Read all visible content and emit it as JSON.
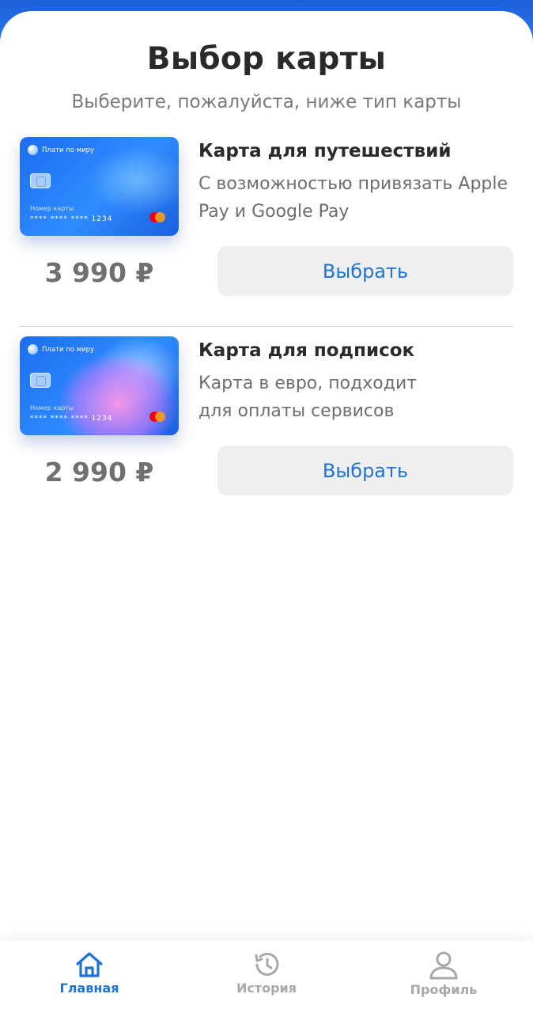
{
  "header": {
    "title": "Выбор карты",
    "subtitle": "Выберите, пожалуйста, ниже тип карты"
  },
  "offers": [
    {
      "card": {
        "brand": "Плати по миру",
        "number_label": "Номер карты",
        "number": "****  ****  ****  1234"
      },
      "title": "Карта для путешествий",
      "description": "С возможностью привязать Apple Pay и Google Pay",
      "price": "3 990 ₽",
      "button_label": "Выбрать"
    },
    {
      "card": {
        "brand": "Плати по миру",
        "number_label": "Номер карты",
        "number": "****  ****  ****  1234"
      },
      "title": "Карта для подписок",
      "description": "Карта в евро, подходит для оплаты сервисов",
      "price": "2 990 ₽",
      "button_label": "Выбрать"
    }
  ],
  "tabbar": {
    "items": [
      {
        "label": "Главная",
        "icon": "home-icon",
        "active": true
      },
      {
        "label": "История",
        "icon": "history-icon",
        "active": false
      },
      {
        "label": "Профиль",
        "icon": "profile-icon",
        "active": false
      }
    ]
  },
  "colors": {
    "accent": "#1f73d8",
    "header_blue": "#1b5fd9",
    "inactive_tab": "#a8a8a8"
  }
}
